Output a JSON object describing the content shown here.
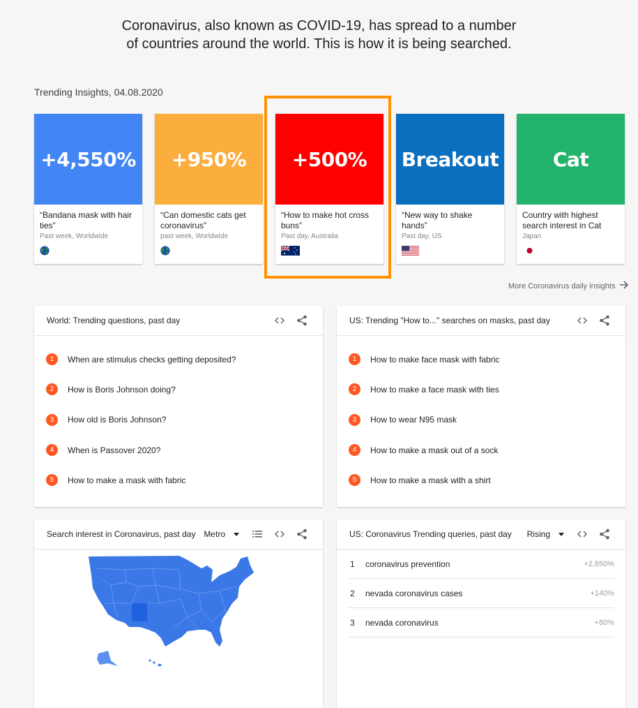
{
  "intro": {
    "line1": "Coronavirus, also known as COVID-19, has spread to a number",
    "line2": "of countries around the world. This is how it is being searched."
  },
  "insights": {
    "label": "Trending Insights, 04.08.2020",
    "cards": [
      {
        "value": "+4,550%",
        "title": "“Bandana mask with hair ties”",
        "subtitle": "Past week, Worldwide",
        "icon": "globe-icon",
        "color": "#4285f4"
      },
      {
        "value": "+950%",
        "title": "“Can domestic cats get coronavirus”",
        "subtitle": "past week, Worldwide",
        "icon": "globe-icon",
        "color": "#fbad3e"
      },
      {
        "value": "+500%",
        "title": "“How to make hot cross buns”",
        "subtitle": "Past day, Australia",
        "icon": "australia-flag-icon",
        "color": "#ff0000"
      },
      {
        "value": "Breakout",
        "title": "“New way to shake hands”",
        "subtitle": "Past day, US",
        "icon": "us-flag-icon",
        "color": "#0b6fbf"
      },
      {
        "value": "Cat",
        "title": "Country with highest search interest in Cat",
        "subtitle": "Japan",
        "icon": "japan-flag-icon",
        "color": "#22b36c"
      }
    ],
    "highlight_color": "#ff9200",
    "more_link": "More Coronavirus daily insights"
  },
  "world_questions": {
    "title": "World: Trending questions, past day",
    "items": [
      {
        "rank": "1",
        "text": "When are stimulus checks getting deposited?"
      },
      {
        "rank": "2",
        "text": "How is Boris Johnson doing?"
      },
      {
        "rank": "3",
        "text": "How old is Boris Johnson?"
      },
      {
        "rank": "4",
        "text": "When is Passover 2020?"
      },
      {
        "rank": "5",
        "text": "How to make a mask with fabric"
      }
    ]
  },
  "us_howto": {
    "title": "US: Trending \"How to...\" searches on masks, past day",
    "items": [
      {
        "rank": "1",
        "text": "How to make face mask with fabric"
      },
      {
        "rank": "2",
        "text": "How to make a face mask with ties"
      },
      {
        "rank": "3",
        "text": "How to wear N95 mask"
      },
      {
        "rank": "4",
        "text": "How to make a mask out of a sock"
      },
      {
        "rank": "5",
        "text": "How to make a mask with a shirt"
      }
    ]
  },
  "interest_map": {
    "title": "Search interest in Coronavirus, past day",
    "dropdown": "Metro",
    "map_color": "#3b78e7"
  },
  "trending_queries": {
    "title": "US: Coronavirus Trending queries, past day",
    "dropdown": "Rising",
    "items": [
      {
        "rank": "1",
        "query": "coronavirus prevention",
        "value": "+2,850%"
      },
      {
        "rank": "2",
        "query": "nevada coronavirus cases",
        "value": "+140%"
      },
      {
        "rank": "3",
        "query": "nevada coronavirus",
        "value": "+80%"
      }
    ]
  }
}
